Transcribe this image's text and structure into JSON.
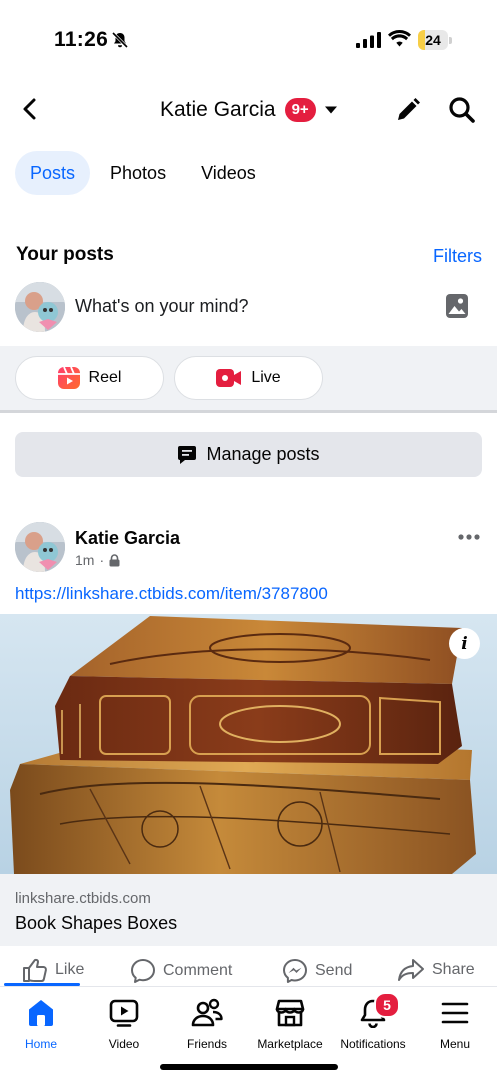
{
  "status_bar": {
    "time": "11:26",
    "battery_level": "24",
    "icons": [
      "bell-muted-icon",
      "cellular-signal-icon",
      "wifi-icon",
      "battery-icon"
    ]
  },
  "header": {
    "title": "Katie Garcia",
    "badge": "9+",
    "icons": [
      "back-arrow-icon",
      "caret-down-icon",
      "pencil-icon",
      "search-icon"
    ]
  },
  "tabs": [
    {
      "label": "Posts",
      "active": true
    },
    {
      "label": "Photos",
      "active": false
    },
    {
      "label": "Videos",
      "active": false
    }
  ],
  "section": {
    "title": "Your posts",
    "filters_label": "Filters"
  },
  "composer": {
    "placeholder": "What's on your mind?",
    "photo_icon": "photo-icon"
  },
  "quick_actions": {
    "reel_label": "Reel",
    "live_label": "Live"
  },
  "manage_posts": {
    "label": "Manage posts"
  },
  "post": {
    "author": "Katie Garcia",
    "time": "1m",
    "separator": "·",
    "privacy_icon": "lock-icon",
    "link_text": "https://linkshare.ctbids.com/item/3787800",
    "link_preview": {
      "domain": "linkshare.ctbids.com",
      "title": "Book Shapes Boxes",
      "info_label": "i"
    },
    "actions": {
      "like": "Like",
      "comment": "Comment",
      "send": "Send",
      "share": "Share"
    }
  },
  "bottom_nav": {
    "items": [
      {
        "label": "Home",
        "icon": "home-icon",
        "active": true
      },
      {
        "label": "Video",
        "icon": "video-icon",
        "active": false
      },
      {
        "label": "Friends",
        "icon": "friends-icon",
        "active": false
      },
      {
        "label": "Marketplace",
        "icon": "marketplace-icon",
        "active": false
      },
      {
        "label": "Notifications",
        "icon": "bell-icon",
        "active": false,
        "badge": "5"
      },
      {
        "label": "Menu",
        "icon": "menu-icon",
        "active": false
      }
    ]
  },
  "colors": {
    "accent": "#0866ff",
    "badge_red": "#e41e3f",
    "tab_active_bg": "#e7f0fd",
    "muted_text": "#65676b",
    "battery_yellow": "#f7ce46"
  }
}
